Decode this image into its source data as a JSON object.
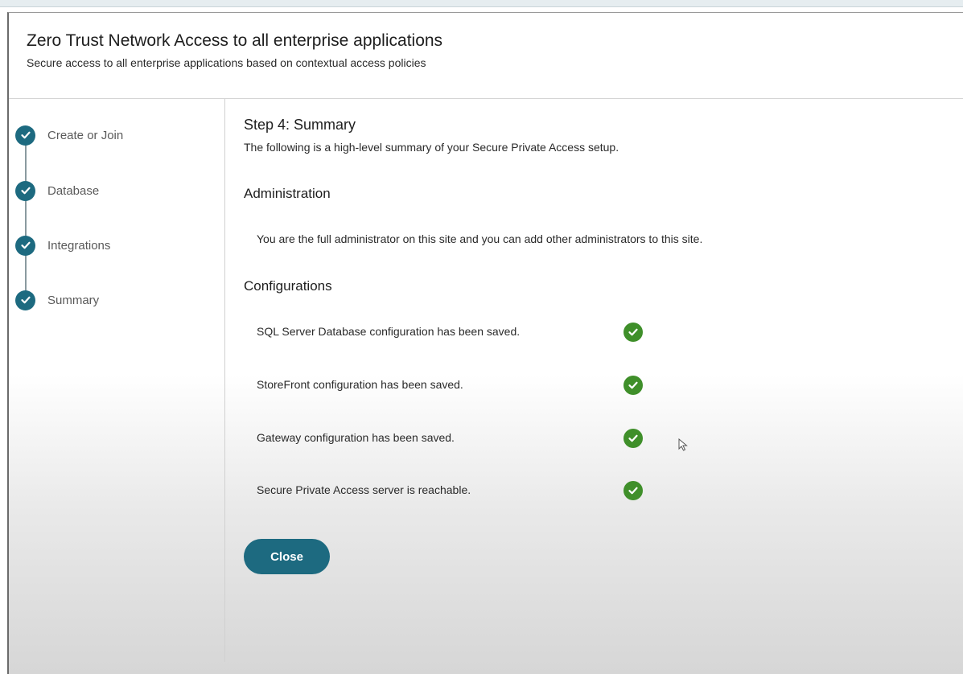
{
  "dialog": {
    "title": "Zero Trust Network Access to all enterprise applications",
    "subtitle": "Secure access to all enterprise applications based on contextual access policies"
  },
  "steps": [
    {
      "label": "Create or Join",
      "status": "complete"
    },
    {
      "label": "Database",
      "status": "complete"
    },
    {
      "label": "Integrations",
      "status": "complete"
    },
    {
      "label": "Summary",
      "status": "complete"
    }
  ],
  "summary": {
    "title": "Step 4: Summary",
    "description": "The following is a high-level summary of your Secure Private Access setup.",
    "administration_heading": "Administration",
    "administration_text": "You are the full administrator on this site and you can add other administrators to this site.",
    "configurations_heading": "Configurations",
    "configurations": [
      {
        "text": "SQL Server Database configuration has been saved.",
        "status": "success"
      },
      {
        "text": "StoreFront configuration has been saved.",
        "status": "success"
      },
      {
        "text": "Gateway configuration has been saved.",
        "status": "success"
      },
      {
        "text": "Secure Private Access server is reachable.",
        "status": "success"
      }
    ]
  },
  "actions": {
    "close_label": "Close"
  },
  "colors": {
    "accent": "#1d6a80",
    "success": "#3f8f2a"
  },
  "icons": {
    "step": "check-circle-icon",
    "config_status": "check-circle-icon",
    "pointer": "mouse-cursor-icon"
  }
}
